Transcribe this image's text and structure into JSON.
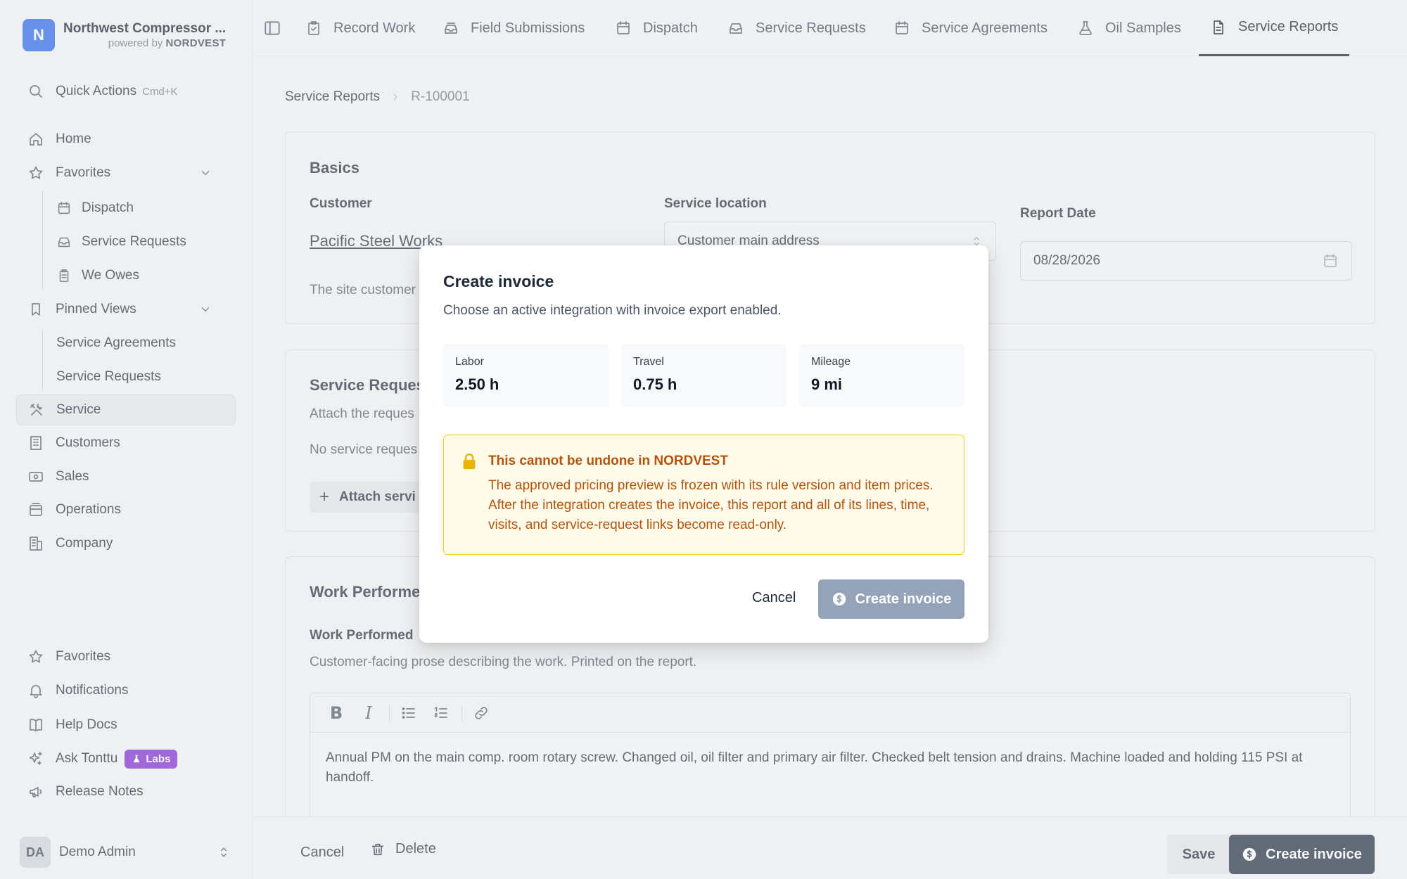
{
  "org": {
    "logo_letter": "N",
    "name": "Northwest Compressor ...",
    "powered_prefix": "powered by",
    "powered_brand": "NORDVEST",
    "brand_color": "#2563eb"
  },
  "sidebar": {
    "quick_actions": {
      "label": "Quick Actions",
      "shortcut": "Cmd+K",
      "icon": "search-icon"
    },
    "home": {
      "label": "Home",
      "icon": "home-icon"
    },
    "favorites": {
      "label": "Favorites",
      "icon": "star-icon",
      "items": [
        {
          "label": "Dispatch",
          "icon": "calendar-icon"
        },
        {
          "label": "Service Requests",
          "icon": "inbox-icon"
        },
        {
          "label": "We Owes",
          "icon": "clipboard-icon"
        }
      ]
    },
    "pinned_views": {
      "label": "Pinned Views",
      "icon": "bookmark-icon",
      "items": [
        {
          "label": "Service Agreements"
        },
        {
          "label": "Service Requests"
        }
      ]
    },
    "sections": [
      {
        "label": "Service",
        "icon": "tools-icon",
        "active": true
      },
      {
        "label": "Customers",
        "icon": "building-icon"
      },
      {
        "label": "Sales",
        "icon": "money-icon"
      },
      {
        "label": "Operations",
        "icon": "archive-icon"
      },
      {
        "label": "Company",
        "icon": "office-icon"
      }
    ],
    "footer": [
      {
        "label": "Favorites",
        "icon": "star-icon"
      },
      {
        "label": "Notifications",
        "icon": "bell-icon"
      },
      {
        "label": "Help Docs",
        "icon": "book-icon"
      },
      {
        "label": "Ask Tonttu",
        "icon": "sparkle-icon",
        "badge": "Labs"
      },
      {
        "label": "Release Notes",
        "icon": "megaphone-icon"
      }
    ],
    "user": {
      "initials": "DA",
      "name": "Demo Admin"
    }
  },
  "topnav": {
    "tabs": [
      {
        "label": "Record Work",
        "icon": "clipboard-check-icon"
      },
      {
        "label": "Field Submissions",
        "icon": "inbox-stack-icon"
      },
      {
        "label": "Dispatch",
        "icon": "calendar-icon"
      },
      {
        "label": "Service Requests",
        "icon": "inbox-icon"
      },
      {
        "label": "Service Agreements",
        "icon": "calendar-icon"
      },
      {
        "label": "Oil Samples",
        "icon": "flask-icon"
      },
      {
        "label": "Service Reports",
        "icon": "document-icon",
        "active": true
      }
    ]
  },
  "breadcrumb": {
    "parent": "Service Reports",
    "current": "R-100001"
  },
  "basics": {
    "title": "Basics",
    "customer_label": "Customer",
    "customer_value": "Pacific Steel Works",
    "customer_hint": "The site customer",
    "location_label": "Service location",
    "location_value": "Customer main address",
    "date_label": "Report Date",
    "date_value": "08/28/2026"
  },
  "service_requests": {
    "title": "Service Reques",
    "hint": "Attach the reques",
    "empty": "No service reques",
    "attach_label": "Attach servi"
  },
  "work_performed": {
    "title": "Work Performe",
    "field_label": "Work Performed",
    "hint": "Customer-facing prose describing the work. Printed on the report.",
    "text": "Annual PM on the main comp. room rotary screw. Changed oil, oil filter and primary air filter. Checked belt tension and drains. Machine loaded and holding 115 PSI at handoff."
  },
  "bottombar": {
    "cancel": "Cancel",
    "delete": "Delete",
    "save": "Save",
    "create_invoice": "Create invoice"
  },
  "modal": {
    "title": "Create invoice",
    "subtitle": "Choose an active integration with invoice export enabled.",
    "stats": [
      {
        "label": "Labor",
        "value": "2.50 h"
      },
      {
        "label": "Travel",
        "value": "0.75 h"
      },
      {
        "label": "Mileage",
        "value": "9 mi"
      }
    ],
    "warning": {
      "title": "This cannot be undone in NORDVEST",
      "body": "The approved pricing preview is frozen with its rule version and item prices. After the integration creates the invoice, this report and all of its lines, time, visits, and service-request links become read-only.",
      "color": "#b45309"
    },
    "cancel": "Cancel",
    "create": "Create invoice",
    "create_disabled_color": "#94a3b8"
  }
}
